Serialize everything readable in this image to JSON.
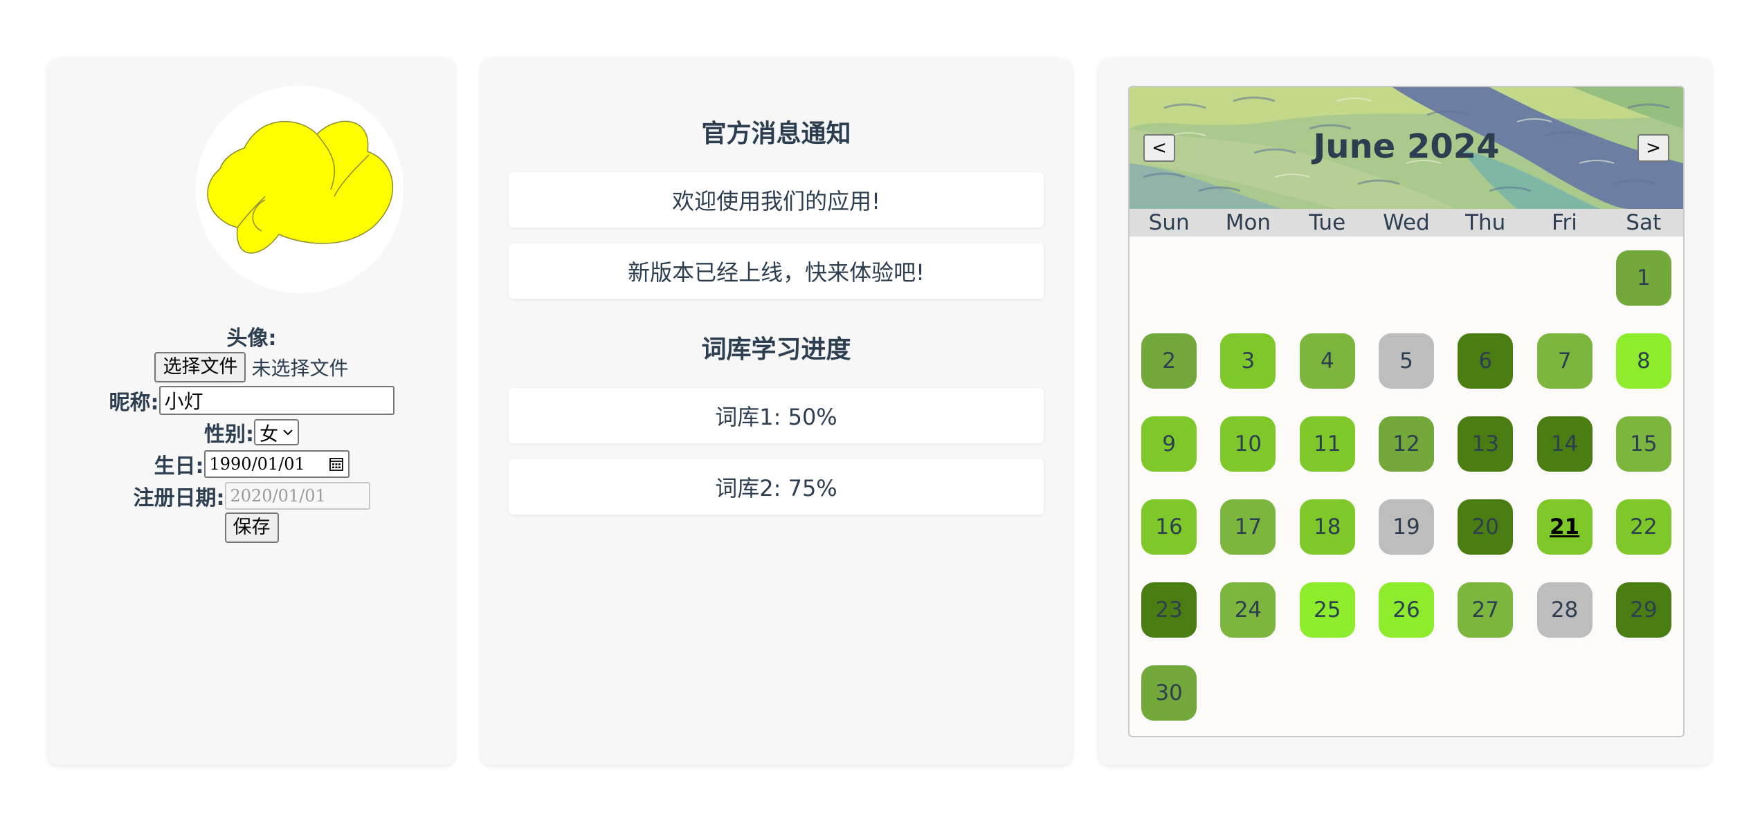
{
  "profile": {
    "avatar_label": "头像:",
    "file_button": "选择文件",
    "file_status": "未选择文件",
    "nickname_label": "昵称:",
    "nickname_value": "小灯",
    "gender_label": "性别:",
    "gender_value": "女",
    "birthday_label": "生日:",
    "birthday_value": "1990/01/01",
    "register_label": "注册日期:",
    "register_value": "2020/01/01",
    "save_button": "保存"
  },
  "messages": {
    "notice_title": "官方消息通知",
    "notices": [
      "欢迎使用我们的应用!",
      "新版本已经上线，快来体验吧!"
    ],
    "progress_title": "词库学习进度",
    "progress": [
      "词库1: 50%",
      "词库2: 75%"
    ]
  },
  "calendar": {
    "title": "June 2024",
    "prev": "<",
    "next": ">",
    "weekdays": [
      "Sun",
      "Mon",
      "Tue",
      "Wed",
      "Thu",
      "Fri",
      "Sat"
    ],
    "first_weekday": 6,
    "today": 21,
    "colors": {
      "mid": "#72a93a",
      "light": "#7cb63e",
      "bright": "#7ec82a",
      "lime": "#8ded2d",
      "dark": "#4a7e12",
      "gray": "#bdbdbd"
    },
    "days": [
      {
        "n": "1",
        "c": "mid"
      },
      {
        "n": "2",
        "c": "mid"
      },
      {
        "n": "3",
        "c": "bright"
      },
      {
        "n": "4",
        "c": "light"
      },
      {
        "n": "5",
        "c": "gray"
      },
      {
        "n": "6",
        "c": "dark"
      },
      {
        "n": "7",
        "c": "light"
      },
      {
        "n": "8",
        "c": "lime"
      },
      {
        "n": "9",
        "c": "bright"
      },
      {
        "n": "10",
        "c": "bright"
      },
      {
        "n": "11",
        "c": "bright"
      },
      {
        "n": "12",
        "c": "mid"
      },
      {
        "n": "13",
        "c": "dark"
      },
      {
        "n": "14",
        "c": "dark"
      },
      {
        "n": "15",
        "c": "light"
      },
      {
        "n": "16",
        "c": "bright"
      },
      {
        "n": "17",
        "c": "light"
      },
      {
        "n": "18",
        "c": "bright"
      },
      {
        "n": "19",
        "c": "gray"
      },
      {
        "n": "20",
        "c": "dark"
      },
      {
        "n": "21",
        "c": "bright"
      },
      {
        "n": "22",
        "c": "bright"
      },
      {
        "n": "23",
        "c": "dark"
      },
      {
        "n": "24",
        "c": "light"
      },
      {
        "n": "25",
        "c": "lime"
      },
      {
        "n": "26",
        "c": "lime"
      },
      {
        "n": "27",
        "c": "light"
      },
      {
        "n": "28",
        "c": "gray"
      },
      {
        "n": "29",
        "c": "dark"
      },
      {
        "n": "30",
        "c": "mid"
      }
    ]
  }
}
